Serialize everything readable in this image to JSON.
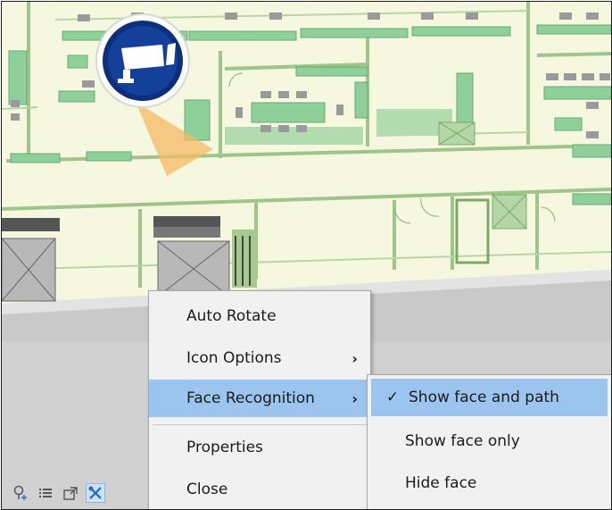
{
  "map": {
    "background": "#f6f7df",
    "panel": "#cfcfcf"
  },
  "camera": {
    "icon": "security-camera-icon",
    "accent": "#0b2f7c"
  },
  "toolbar": {
    "buttons": [
      {
        "icon": "map-pin-icon"
      },
      {
        "icon": "list-icon"
      },
      {
        "icon": "map-export-icon"
      },
      {
        "icon": "tools-icon",
        "active": true
      }
    ]
  },
  "context_menu": {
    "items": [
      {
        "label": "Auto Rotate"
      },
      {
        "label": "Icon Options",
        "has_submenu": true,
        "chevron": "›"
      },
      {
        "label": "Face Recognition",
        "has_submenu": true,
        "chevron": "›",
        "highlighted": true
      },
      {
        "label": "Properties"
      },
      {
        "label": "Close"
      }
    ]
  },
  "submenu": {
    "items": [
      {
        "label": "Show face and path",
        "checked": true,
        "check": "✓",
        "highlighted": true
      },
      {
        "label": "Show face only"
      },
      {
        "label": "Hide face"
      }
    ]
  }
}
